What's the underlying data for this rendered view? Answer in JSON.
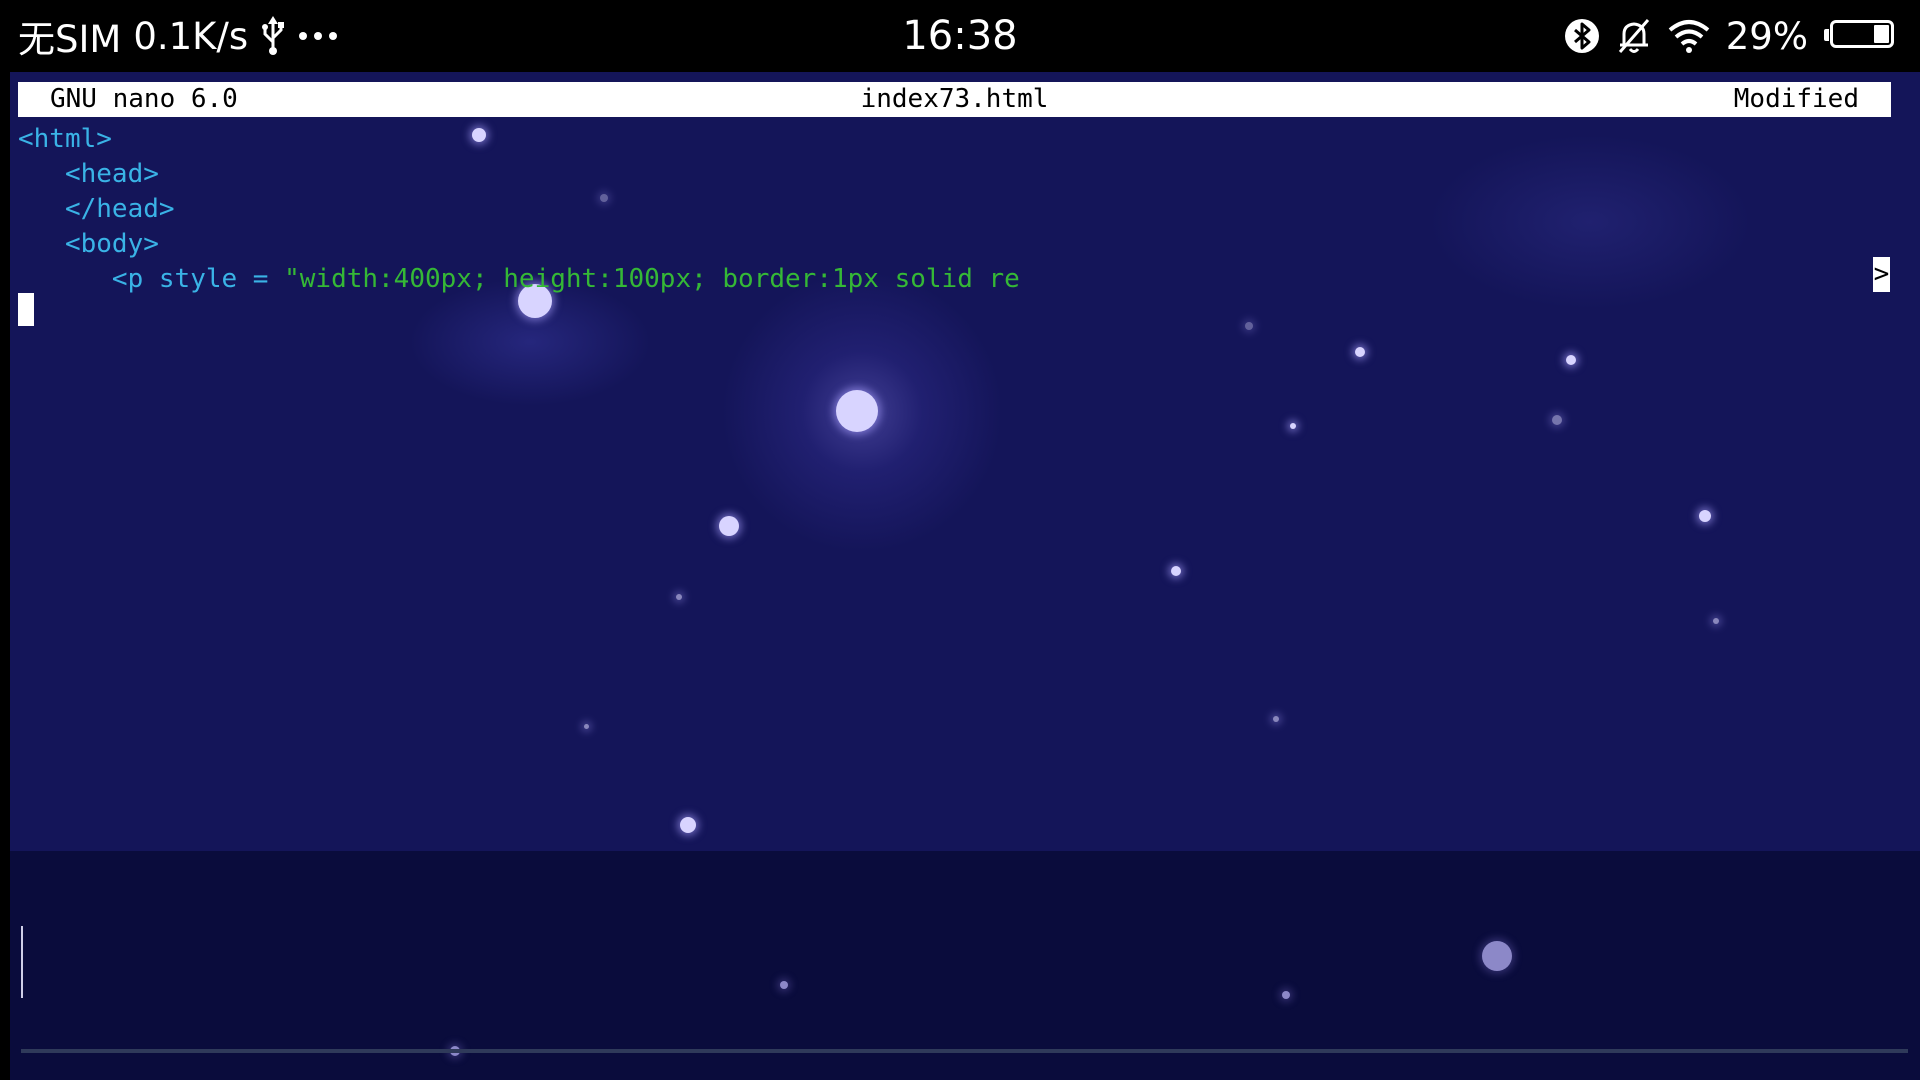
{
  "status_bar": {
    "carrier": "无SIM",
    "net_speed": "0.1K/s",
    "usb_icon": "usb-icon",
    "more_icon": "more-dots-icon",
    "time": "16:38",
    "bluetooth_icon": "bluetooth-icon",
    "mute_icon": "notifications-off-icon",
    "wifi_icon": "wifi-icon",
    "battery_percent": "29%",
    "battery_level": 0.29
  },
  "nano": {
    "title_left": "GNU nano 6.0",
    "title_center": "index73.html",
    "title_right": "Modified",
    "overflow_marker": ">",
    "lines": {
      "l1": "<html>",
      "l2": "<head>",
      "l3": "</head>",
      "l4": "<body>",
      "l5_tag": "<p style = ",
      "l5_str": "\"width:400px; height:100px; border:1px solid re"
    }
  },
  "colors": {
    "background": "#141559",
    "tag": "#3ab3e6",
    "string": "#35b836",
    "titlebar": "#ffffff"
  }
}
